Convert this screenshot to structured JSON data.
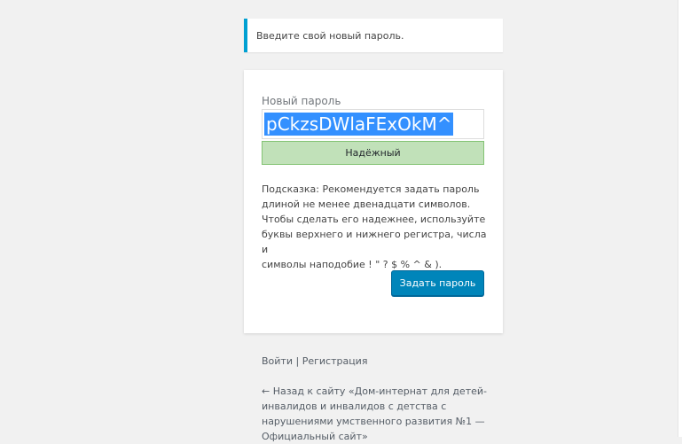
{
  "notice": {
    "message": "Введите свой новый пароль."
  },
  "form": {
    "password_label": "Новый пароль",
    "password_value": "pCkzsDWlaFExOkM^",
    "strength_label": "Надёжный",
    "hint_lines": [
      "Подсказка: Рекомендуется задать пароль",
      "длиной не менее двенадцати символов.",
      "Чтобы сделать его надежнее, используйте",
      "буквы верхнего и нижнего регистра, числа и",
      "символы наподобие ! \" ? $ % ^ & )."
    ],
    "submit_label": "Задать пароль"
  },
  "nav": {
    "login_label": "Войти",
    "separator": " | ",
    "register_label": "Регистрация"
  },
  "backlink": {
    "lines": [
      "← Назад к сайту «Дом-интернат для детей-",
      "инвалидов и инвалидов с детства с",
      "нарушениями умственного развития №1 —",
      "Официальный сайт»"
    ]
  },
  "colors": {
    "background": "#f1f1f1",
    "notice_accent": "#00a0d2",
    "strength_good": "#c1e1b9",
    "primary_button": "#0085ba",
    "selection": "#3390ff"
  }
}
